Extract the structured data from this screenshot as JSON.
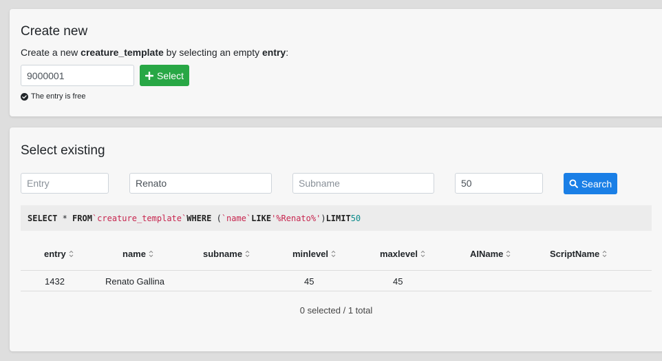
{
  "create": {
    "title": "Create new",
    "desc_prefix": "Create a new ",
    "desc_table": "creature_template",
    "desc_middle": " by selecting an empty ",
    "desc_field": "entry",
    "desc_suffix": ":",
    "entry_value": "9000001",
    "select_label": "Select",
    "status_text": "The entry is free"
  },
  "select": {
    "title": "Select existing",
    "entry_placeholder": "Entry",
    "name_value": "Renato",
    "subname_placeholder": "Subname",
    "limit_value": "50",
    "search_label": "Search"
  },
  "sql": {
    "select_kw": "SELECT",
    "star": " * ",
    "from_kw": "FROM",
    "table": "`creature_template`",
    "where_kw": "WHERE",
    "open": " (",
    "column": "`name`",
    "like_kw": "LIKE",
    "pattern": "'%Renato%'",
    "close": ")",
    "limit_kw": "LIMIT",
    "limit": "50"
  },
  "table": {
    "headers": [
      "entry",
      "name",
      "subname",
      "minlevel",
      "maxlevel",
      "AIName",
      "ScriptName"
    ],
    "rows": [
      [
        "1432",
        "Renato Gallina",
        "",
        "45",
        "45",
        "",
        ""
      ]
    ],
    "footer": "0 selected / 1 total"
  },
  "colors": {
    "success": "#28a745",
    "primary": "#1a7fe6",
    "sql_string": "#c7254e",
    "sql_number": "#0a8a8a"
  }
}
